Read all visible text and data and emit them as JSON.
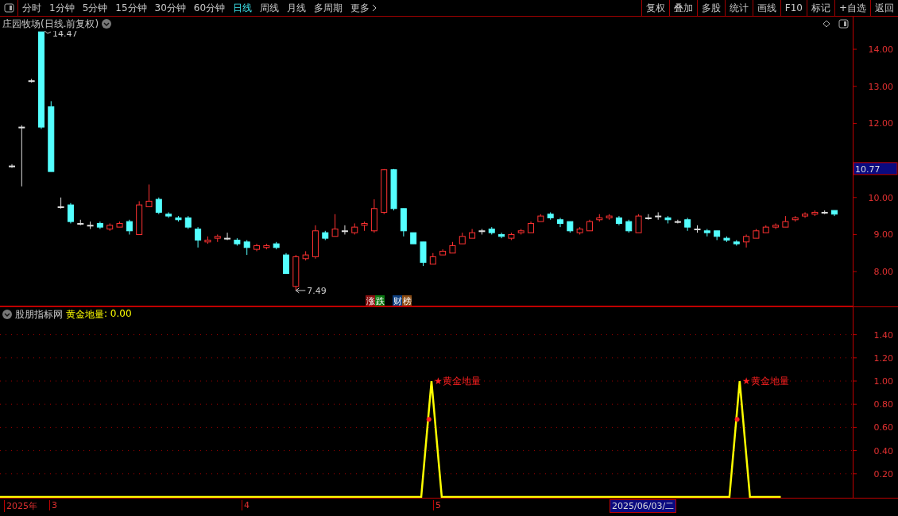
{
  "toolbar": {
    "periods": [
      {
        "label": "分时",
        "selected": false
      },
      {
        "label": "1分钟",
        "selected": false
      },
      {
        "label": "5分钟",
        "selected": false
      },
      {
        "label": "15分钟",
        "selected": false
      },
      {
        "label": "30分钟",
        "selected": false
      },
      {
        "label": "60分钟",
        "selected": false
      },
      {
        "label": "日线",
        "selected": true
      },
      {
        "label": "周线",
        "selected": false
      },
      {
        "label": "月线",
        "selected": false
      },
      {
        "label": "多周期",
        "selected": false
      }
    ],
    "more": "更多",
    "actions": [
      "复权",
      "叠加",
      "多股",
      "统计",
      "画线",
      "F10",
      "标记",
      "+自选",
      "返回"
    ]
  },
  "main_chart": {
    "title": "庄园牧场(日线.前复权)",
    "high_label": "14.47",
    "low_label": "7.49",
    "current_price": "10.77",
    "badges": [
      {
        "text": "涨",
        "color": "#8a1010"
      },
      {
        "text": "跌",
        "color": "#0b7a12"
      },
      {
        "text": "财",
        "color": "#0d3f80"
      },
      {
        "text": "榜",
        "color": "#8a4a12"
      }
    ],
    "chart_data": {
      "type": "candlestick",
      "ylim": [
        7.06,
        14.88
      ],
      "yticks": [
        {
          "value": 14,
          "label": "14.00"
        },
        {
          "value": 13,
          "label": "13.00"
        },
        {
          "value": 12,
          "label": "12.00"
        },
        {
          "value": 10,
          "label": "10.00"
        },
        {
          "value": 9,
          "label": "9.00"
        },
        {
          "value": 8,
          "label": "8.00"
        }
      ],
      "ohlc": [
        [
          10.85,
          10.9,
          10.8,
          10.85
        ],
        [
          11.9,
          11.95,
          10.3,
          11.9
        ],
        [
          13.15,
          13.2,
          13.1,
          13.15
        ],
        [
          14.47,
          14.47,
          11.85,
          11.9
        ],
        [
          12.45,
          12.6,
          10.7,
          10.7
        ],
        [
          9.75,
          10.0,
          9.7,
          9.75
        ],
        [
          9.8,
          9.85,
          9.3,
          9.35
        ],
        [
          9.3,
          9.4,
          9.25,
          9.3
        ],
        [
          9.25,
          9.35,
          9.15,
          9.25
        ],
        [
          9.3,
          9.35,
          9.15,
          9.2
        ],
        [
          9.15,
          9.3,
          9.1,
          9.25
        ],
        [
          9.2,
          9.35,
          9.2,
          9.3
        ],
        [
          9.35,
          9.4,
          9.0,
          9.1
        ],
        [
          9.0,
          9.9,
          9.0,
          9.8
        ],
        [
          9.75,
          10.35,
          9.75,
          9.9
        ],
        [
          9.95,
          10.0,
          9.55,
          9.6
        ],
        [
          9.55,
          9.6,
          9.45,
          9.5
        ],
        [
          9.45,
          9.5,
          9.35,
          9.4
        ],
        [
          9.45,
          9.5,
          9.15,
          9.2
        ],
        [
          9.15,
          9.2,
          8.65,
          8.85
        ],
        [
          8.8,
          8.95,
          8.75,
          8.85
        ],
        [
          8.9,
          9.0,
          8.8,
          8.95
        ],
        [
          8.9,
          9.05,
          8.85,
          8.9
        ],
        [
          8.85,
          8.9,
          8.7,
          8.75
        ],
        [
          8.8,
          8.85,
          8.45,
          8.65
        ],
        [
          8.6,
          8.75,
          8.55,
          8.7
        ],
        [
          8.65,
          8.75,
          8.6,
          8.7
        ],
        [
          8.75,
          8.8,
          8.6,
          8.65
        ],
        [
          8.45,
          8.5,
          7.95,
          7.95
        ],
        [
          7.6,
          8.45,
          7.49,
          8.4
        ],
        [
          8.35,
          8.55,
          8.3,
          8.45
        ],
        [
          8.4,
          9.25,
          8.35,
          9.1
        ],
        [
          9.05,
          9.1,
          8.85,
          8.9
        ],
        [
          8.95,
          9.55,
          8.95,
          9.15
        ],
        [
          9.1,
          9.25,
          9.0,
          9.1
        ],
        [
          9.05,
          9.3,
          9.0,
          9.2
        ],
        [
          9.25,
          9.35,
          9.1,
          9.3
        ],
        [
          9.1,
          9.95,
          9.05,
          9.7
        ],
        [
          9.6,
          10.77,
          9.55,
          10.75
        ],
        [
          10.75,
          10.77,
          9.65,
          9.7
        ],
        [
          9.7,
          9.7,
          8.95,
          9.1
        ],
        [
          9.05,
          9.05,
          8.75,
          8.75
        ],
        [
          8.8,
          8.8,
          8.15,
          8.25
        ],
        [
          8.2,
          8.5,
          8.2,
          8.4
        ],
        [
          8.45,
          8.6,
          8.45,
          8.55
        ],
        [
          8.5,
          8.8,
          8.5,
          8.7
        ],
        [
          8.75,
          9.05,
          8.75,
          8.95
        ],
        [
          8.9,
          9.15,
          8.9,
          9.05
        ],
        [
          9.1,
          9.15,
          9.0,
          9.1
        ],
        [
          9.15,
          9.2,
          9.0,
          9.05
        ],
        [
          9.0,
          9.05,
          8.9,
          8.95
        ],
        [
          8.9,
          9.05,
          8.85,
          9.0
        ],
        [
          9.05,
          9.15,
          9.0,
          9.1
        ],
        [
          9.05,
          9.35,
          9.05,
          9.3
        ],
        [
          9.35,
          9.55,
          9.35,
          9.5
        ],
        [
          9.55,
          9.6,
          9.4,
          9.45
        ],
        [
          9.4,
          9.45,
          9.2,
          9.3
        ],
        [
          9.35,
          9.35,
          9.05,
          9.1
        ],
        [
          9.05,
          9.2,
          9.0,
          9.15
        ],
        [
          9.1,
          9.4,
          9.1,
          9.35
        ],
        [
          9.4,
          9.55,
          9.35,
          9.45
        ],
        [
          9.45,
          9.55,
          9.4,
          9.5
        ],
        [
          9.45,
          9.5,
          9.25,
          9.3
        ],
        [
          9.35,
          9.4,
          9.05,
          9.1
        ],
        [
          9.05,
          9.55,
          9.05,
          9.5
        ],
        [
          9.45,
          9.55,
          9.4,
          9.45
        ],
        [
          9.5,
          9.6,
          9.4,
          9.5
        ],
        [
          9.45,
          9.5,
          9.3,
          9.4
        ],
        [
          9.35,
          9.4,
          9.3,
          9.35
        ],
        [
          9.4,
          9.45,
          9.1,
          9.2
        ],
        [
          9.15,
          9.25,
          9.05,
          9.15
        ],
        [
          9.1,
          9.15,
          8.95,
          9.05
        ],
        [
          9.1,
          9.1,
          8.85,
          8.95
        ],
        [
          8.9,
          8.95,
          8.8,
          8.85
        ],
        [
          8.8,
          8.85,
          8.7,
          8.75
        ],
        [
          8.8,
          9.0,
          8.65,
          8.95
        ],
        [
          8.9,
          9.15,
          8.9,
          9.1
        ],
        [
          9.05,
          9.25,
          9.05,
          9.2
        ],
        [
          9.2,
          9.3,
          9.15,
          9.25
        ],
        [
          9.2,
          9.5,
          9.2,
          9.35
        ],
        [
          9.4,
          9.5,
          9.35,
          9.45
        ],
        [
          9.5,
          9.6,
          9.45,
          9.55
        ],
        [
          9.55,
          9.65,
          9.5,
          9.6
        ],
        [
          9.6,
          9.65,
          9.55,
          9.6
        ],
        [
          9.65,
          9.65,
          9.5,
          9.55
        ]
      ]
    }
  },
  "indicator": {
    "source": "股朋指标网",
    "value": ": 0.00",
    "chart_data": {
      "type": "line",
      "ylim": [
        0,
        1.637
      ],
      "grid": true,
      "yticks": [
        {
          "value": 1.4,
          "label": "1.40"
        },
        {
          "value": 1.2,
          "label": "1.20"
        },
        {
          "value": 1,
          "label": "1.00"
        },
        {
          "value": 0.8,
          "label": "0.80"
        },
        {
          "value": 0.6,
          "label": "0.60"
        },
        {
          "value": 0.4,
          "label": "0.40"
        },
        {
          "value": 0.2,
          "label": "0.20"
        }
      ],
      "series": [
        {
          "name": "黄金地量",
          "color": "#ffff00",
          "values": [
            0,
            0,
            0,
            0,
            0,
            0,
            0,
            0,
            0,
            0,
            0,
            0,
            0,
            0,
            0,
            0,
            0,
            0,
            0,
            0,
            0,
            0,
            0,
            0,
            0,
            0,
            0,
            0,
            0,
            0,
            0,
            0,
            0,
            0,
            0,
            0,
            0,
            0,
            0,
            0,
            0,
            0,
            1,
            0,
            0,
            0,
            0,
            0,
            0,
            0,
            0,
            0,
            0,
            0,
            0,
            0,
            0,
            0,
            0,
            0,
            0,
            0,
            0,
            0,
            0,
            0,
            0,
            0,
            0,
            0,
            0,
            0,
            1,
            0,
            0,
            0,
            0,
            null,
            null,
            null,
            null,
            null,
            null,
            null
          ]
        }
      ],
      "annotations": [
        "★黄金地量",
        "★黄金地量"
      ]
    }
  },
  "time_axis": {
    "labels": [
      {
        "text": "2025年"
      },
      {
        "text": "3"
      },
      {
        "text": "4"
      },
      {
        "text": "5"
      }
    ],
    "cursor_date": "2025/06/03/二"
  }
}
